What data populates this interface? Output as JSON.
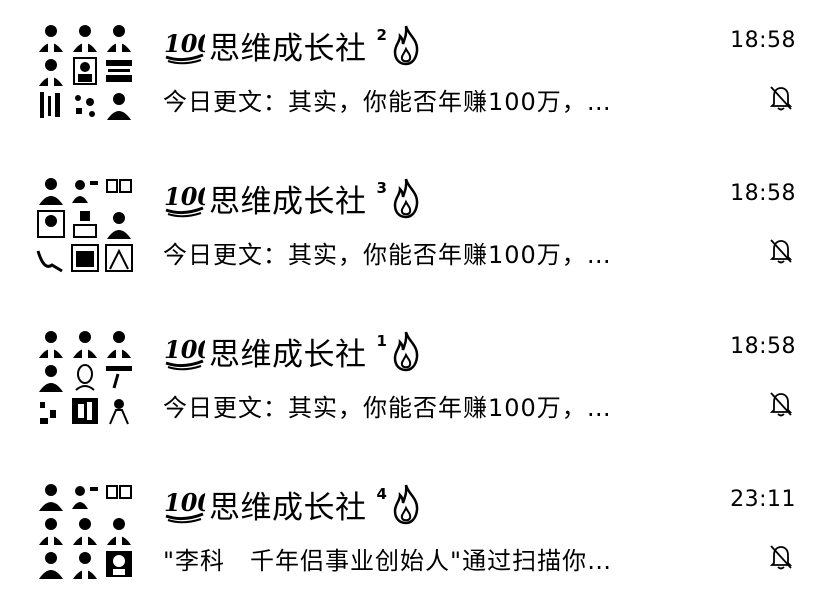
{
  "chats": [
    {
      "name": "思维成长社",
      "badge_number": "2",
      "time": "18:58",
      "preview": "今日更文：其实，你能否年赚100万，…",
      "muted": true
    },
    {
      "name": "思维成长社",
      "badge_number": "3",
      "time": "18:58",
      "preview": "今日更文：其实，你能否年赚100万，…",
      "muted": true
    },
    {
      "name": "思维成长社",
      "badge_number": "1",
      "time": "18:58",
      "preview": "今日更文：其实，你能否年赚100万，…",
      "muted": true
    },
    {
      "name": "思维成长社",
      "badge_number": "4",
      "time": "23:11",
      "preview": "\"李科　千年侣事业创始人\"通过扫描你…",
      "muted": true
    }
  ],
  "icons": {
    "prefix": "hundred-points-icon",
    "suffix": "fire-icon",
    "status": "bell-slash-icon"
  }
}
